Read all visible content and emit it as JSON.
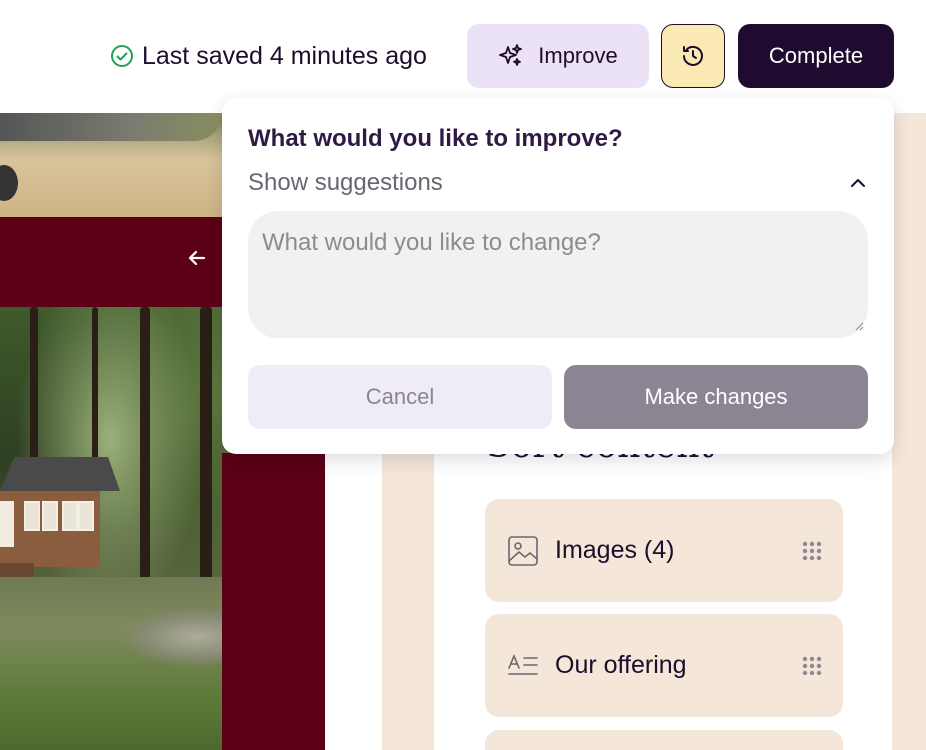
{
  "header": {
    "saved_status": "Last saved 4 minutes ago",
    "improve_label": "Improve",
    "complete_label": "Complete"
  },
  "improve_popover": {
    "title": "What would you like to improve?",
    "suggestions_toggle": "Show suggestions",
    "input_placeholder": "What would you like to change?",
    "input_value": "",
    "cancel_label": "Cancel",
    "submit_label": "Make changes"
  },
  "sort_panel": {
    "title": "Sort content",
    "items": [
      {
        "label": "Images (4)",
        "icon": "image-icon"
      },
      {
        "label": "Our offering",
        "icon": "text-block-icon"
      }
    ]
  },
  "colors": {
    "brand_dark": "#1f0b2f",
    "improve_bg": "#ebe2f5",
    "history_bg": "#fbe9b4",
    "saved_green": "#22a05a",
    "maroon": "#5c0016",
    "cream": "#f4e6d8",
    "make_changes_bg": "#8c8393"
  }
}
